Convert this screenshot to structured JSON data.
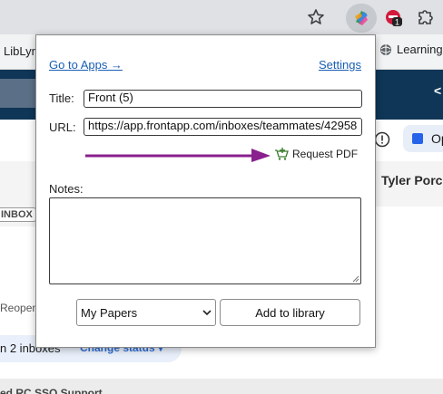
{
  "browser": {
    "bookmark_left": "LibLyr",
    "bookmark_right": "Learning",
    "ext_badge": "1"
  },
  "background": {
    "header_right_char": "<",
    "op_label": "Op",
    "tyler": "Tyler Porc",
    "inbox_tag": "INBOX",
    "reopen": "Reopen",
    "in_inboxes": "n 2 inboxes",
    "change_status": "Change status ▾",
    "bottom_text": "ed RC SSO Support"
  },
  "popup": {
    "go_to_apps": "Go to Apps →",
    "settings": "Settings",
    "title_label": "Title:",
    "title_value": "Front (5)",
    "url_label": "URL:",
    "url_value": "https://app.frontapp.com/inboxes/teammates/42958",
    "request_pdf": "Request PDF",
    "notes_label": "Notes:",
    "notes_value": "",
    "library_select": "My Papers",
    "add_button": "Add to library"
  },
  "colors": {
    "arrow": "#8a1f8e",
    "link": "#1a5fb4",
    "app_header": "#0f3557"
  }
}
